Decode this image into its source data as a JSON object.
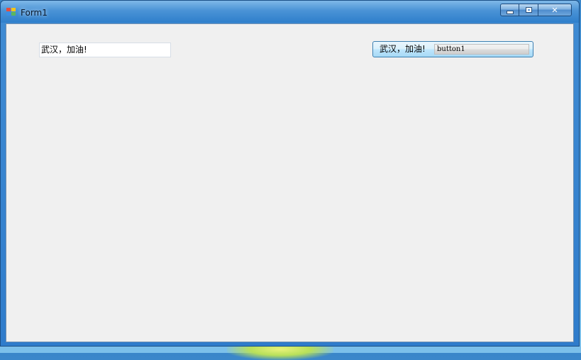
{
  "window": {
    "title": "Form1",
    "icon": "form-app-icon",
    "caption_icons": {
      "minimize": "minimize-icon",
      "maximize": "maximize-icon",
      "close": "close-icon"
    },
    "close_glyph": "✕"
  },
  "form": {
    "textbox_value": "武汉，加油!",
    "button_text": "武汉，加油!",
    "button_inner_text": "button1"
  },
  "colors": {
    "titlebar": "#2f7fcb",
    "client_bg": "#f0f0f0",
    "button_border": "#3c7fb1"
  }
}
